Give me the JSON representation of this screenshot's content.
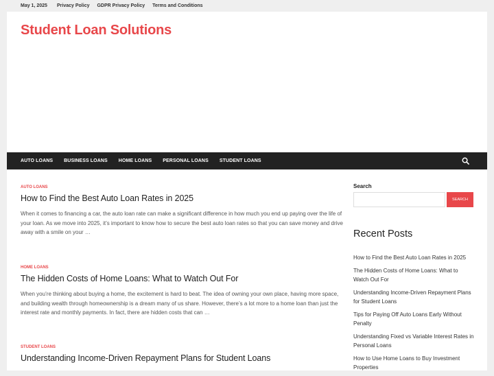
{
  "topbar": {
    "date": "May 1, 2025",
    "links": [
      "Privacy Policy",
      "GDPR Privacy Policy",
      "Terms and Conditions"
    ]
  },
  "site": {
    "title": "Student Loan Solutions"
  },
  "nav": {
    "items": [
      "AUTO LOANS",
      "BUSINESS LOANS",
      "HOME LOANS",
      "PERSONAL LOANS",
      "STUDENT LOANS"
    ],
    "search_icon": "search-icon"
  },
  "posts": [
    {
      "category": "AUTO LOANS",
      "title": "How to Find the Best Auto Loan Rates in 2025",
      "excerpt": "When it comes to financing a car, the auto loan rate can make a significant difference in how much you end up paying over the life of your loan. As we move into 2025, it’s important to know how to secure the best auto loan rates so that you can save money and drive away with a smile on your …"
    },
    {
      "category": "HOME LOANS",
      "title": "The Hidden Costs of Home Loans: What to Watch Out For",
      "excerpt": "When you’re thinking about buying a home, the excitement is hard to beat. The idea of owning your own place, having more space, and building wealth through homeownership is a dream many of us share. However, there’s a lot more to a home loan than just the interest rate and monthly payments. In fact, there are hidden costs that can …"
    },
    {
      "category": "STUDENT LOANS",
      "title": "Understanding Income-Driven Repayment Plans for Student Loans",
      "excerpt": ""
    }
  ],
  "sidebar": {
    "search_label": "Search",
    "search_value": "",
    "search_button": "SEARCH",
    "recent_title": "Recent Posts",
    "recent": [
      "How to Find the Best Auto Loan Rates in 2025",
      "The Hidden Costs of Home Loans: What to Watch Out For",
      "Understanding Income-Driven Repayment Plans for Student Loans",
      "Tips for Paying Off Auto Loans Early Without Penalty",
      "Understanding Fixed vs Variable Interest Rates in Personal Loans",
      "How to Use Home Loans to Buy Investment Properties"
    ]
  },
  "colors": {
    "accent": "#e8474a",
    "nav_bg": "#222222",
    "page_bg": "#efefef"
  }
}
